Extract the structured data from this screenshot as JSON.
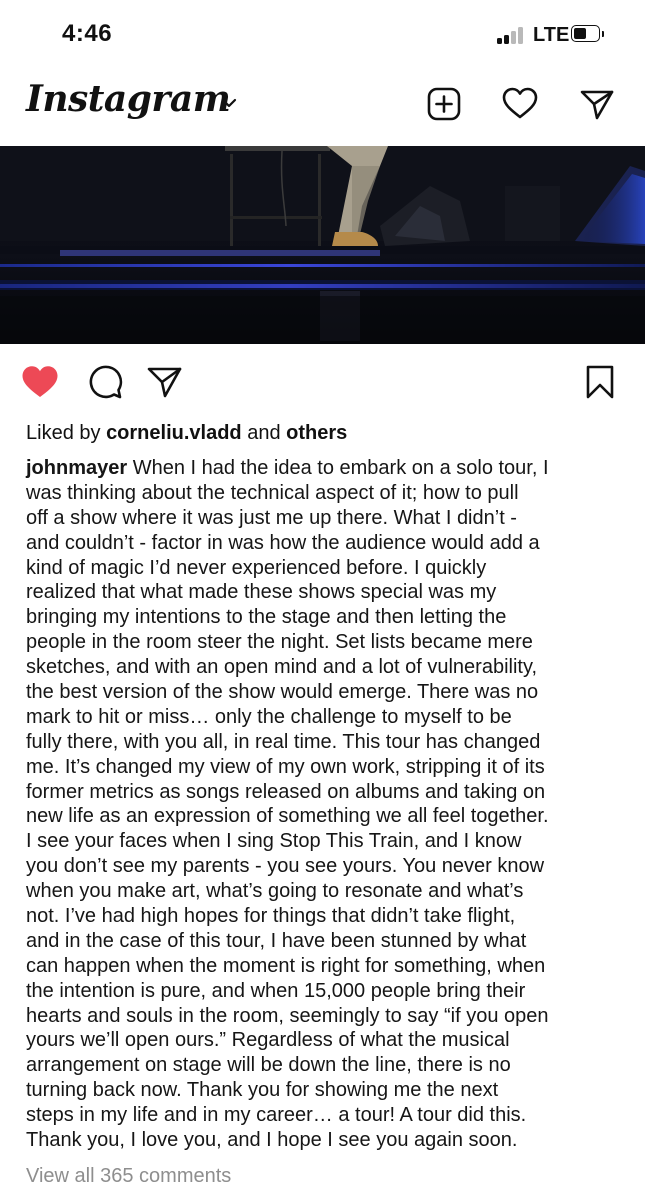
{
  "status_bar": {
    "time": "4:46",
    "network": "LTE"
  },
  "header": {
    "logo": "Instagram",
    "icons": [
      "new-post-icon",
      "heart-icon",
      "direct-message-icon"
    ]
  },
  "post": {
    "liked": true,
    "like_color": "#ed4956",
    "likes": {
      "prefix": "Liked by ",
      "user": "corneliu.vladd",
      "and": " and ",
      "others": "others"
    },
    "caption": {
      "username": "johnmayer",
      "lines": [
        " When I had the idea to embark on a solo tour, I",
        "was thinking about the technical aspect of it; how to pull",
        "off a show where it was just me up there. What I didn’t -",
        "and couldn’t - factor in was how the audience would add a",
        "kind of magic I’d never experienced before. I quickly",
        "realized that what made these shows special was my",
        "bringing my intentions to the stage and then letting the",
        "people in the room steer the night. Set lists became mere",
        "sketches, and with an open mind and a lot of vulnerability,",
        "the best version of the show would emerge. There was no",
        "mark to hit or miss… only the challenge to myself to be",
        "fully there, with you all, in real time. This tour has changed",
        "me. It’s changed my view of my own work, stripping it of its",
        "former metrics as songs released on albums and taking on",
        "new life as an expression of something we all feel together.",
        "I see your faces when I sing Stop This Train, and I know",
        "you don’t see my parents - you see yours. You never know",
        "when you make art, what’s going to resonate and what’s",
        "not. I’ve had high hopes for things that didn’t take flight,",
        "and in the case of this tour, I have been stunned by what",
        "can happen when the moment is right for something, when",
        "the intention is pure, and when 15,000 people bring their",
        "hearts and souls in the room, seemingly to say “if you open",
        "yours we’ll open ours.” Regardless of what the musical",
        "arrangement on stage will be down the line, there is no",
        "turning back now. Thank you for showing me the next",
        "steps in my life and in my career…  a tour!  A tour did this.",
        "Thank you, I love you, and I hope I see you again soon."
      ]
    },
    "view_comments": "View all 365 comments"
  }
}
